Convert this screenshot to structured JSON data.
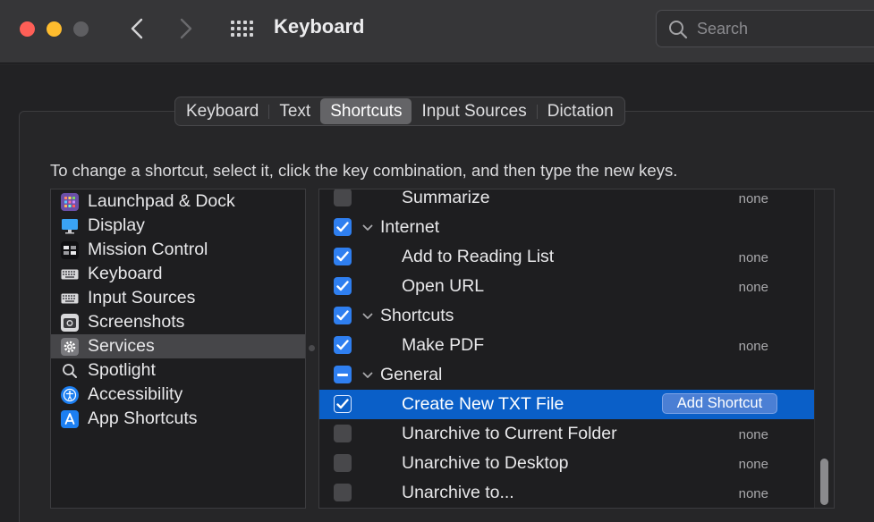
{
  "window": {
    "title": "Keyboard",
    "search_placeholder": "Search"
  },
  "tabs": [
    {
      "label": "Keyboard",
      "active": false
    },
    {
      "label": "Text",
      "active": false
    },
    {
      "label": "Shortcuts",
      "active": true
    },
    {
      "label": "Input Sources",
      "active": false
    },
    {
      "label": "Dictation",
      "active": false
    }
  ],
  "instructions": "To change a shortcut, select it, click the key combination, and then type the new keys.",
  "categories": [
    {
      "label": "Launchpad & Dock",
      "icon": "launchpad-icon",
      "selected": false
    },
    {
      "label": "Display",
      "icon": "display-icon",
      "selected": false
    },
    {
      "label": "Mission Control",
      "icon": "mission-control-icon",
      "selected": false
    },
    {
      "label": "Keyboard",
      "icon": "keyboard-icon",
      "selected": false
    },
    {
      "label": "Input Sources",
      "icon": "input-sources-icon",
      "selected": false
    },
    {
      "label": "Screenshots",
      "icon": "screenshot-icon",
      "selected": false
    },
    {
      "label": "Services",
      "icon": "gear-icon",
      "selected": true
    },
    {
      "label": "Spotlight",
      "icon": "spotlight-icon",
      "selected": false
    },
    {
      "label": "Accessibility",
      "icon": "accessibility-icon",
      "selected": false
    },
    {
      "label": "App Shortcuts",
      "icon": "app-shortcuts-icon",
      "selected": false
    }
  ],
  "shortcuts": [
    {
      "label": "Summarize",
      "type": "item",
      "checked": "off",
      "shortcut": "none"
    },
    {
      "label": "Internet",
      "type": "group",
      "checked": "on"
    },
    {
      "label": "Add to Reading List",
      "type": "item",
      "checked": "on",
      "shortcut": "none"
    },
    {
      "label": "Open URL",
      "type": "item",
      "checked": "on",
      "shortcut": "none"
    },
    {
      "label": "Shortcuts",
      "type": "group",
      "checked": "on"
    },
    {
      "label": "Make PDF",
      "type": "item",
      "checked": "on",
      "shortcut": "none"
    },
    {
      "label": "General",
      "type": "group",
      "checked": "mixed"
    },
    {
      "label": "Create New TXT File",
      "type": "item",
      "checked": "on",
      "selected": true,
      "button": "Add Shortcut"
    },
    {
      "label": "Unarchive to Current Folder",
      "type": "item",
      "checked": "off",
      "shortcut": "none"
    },
    {
      "label": "Unarchive to Desktop",
      "type": "item",
      "checked": "off",
      "shortcut": "none"
    },
    {
      "label": "Unarchive to...",
      "type": "item",
      "checked": "off",
      "shortcut": "none"
    }
  ],
  "colors": {
    "accent": "#2f7ff0",
    "selection": "#0a5fc8",
    "close": "#fe5f57",
    "minimize": "#febc2e"
  }
}
